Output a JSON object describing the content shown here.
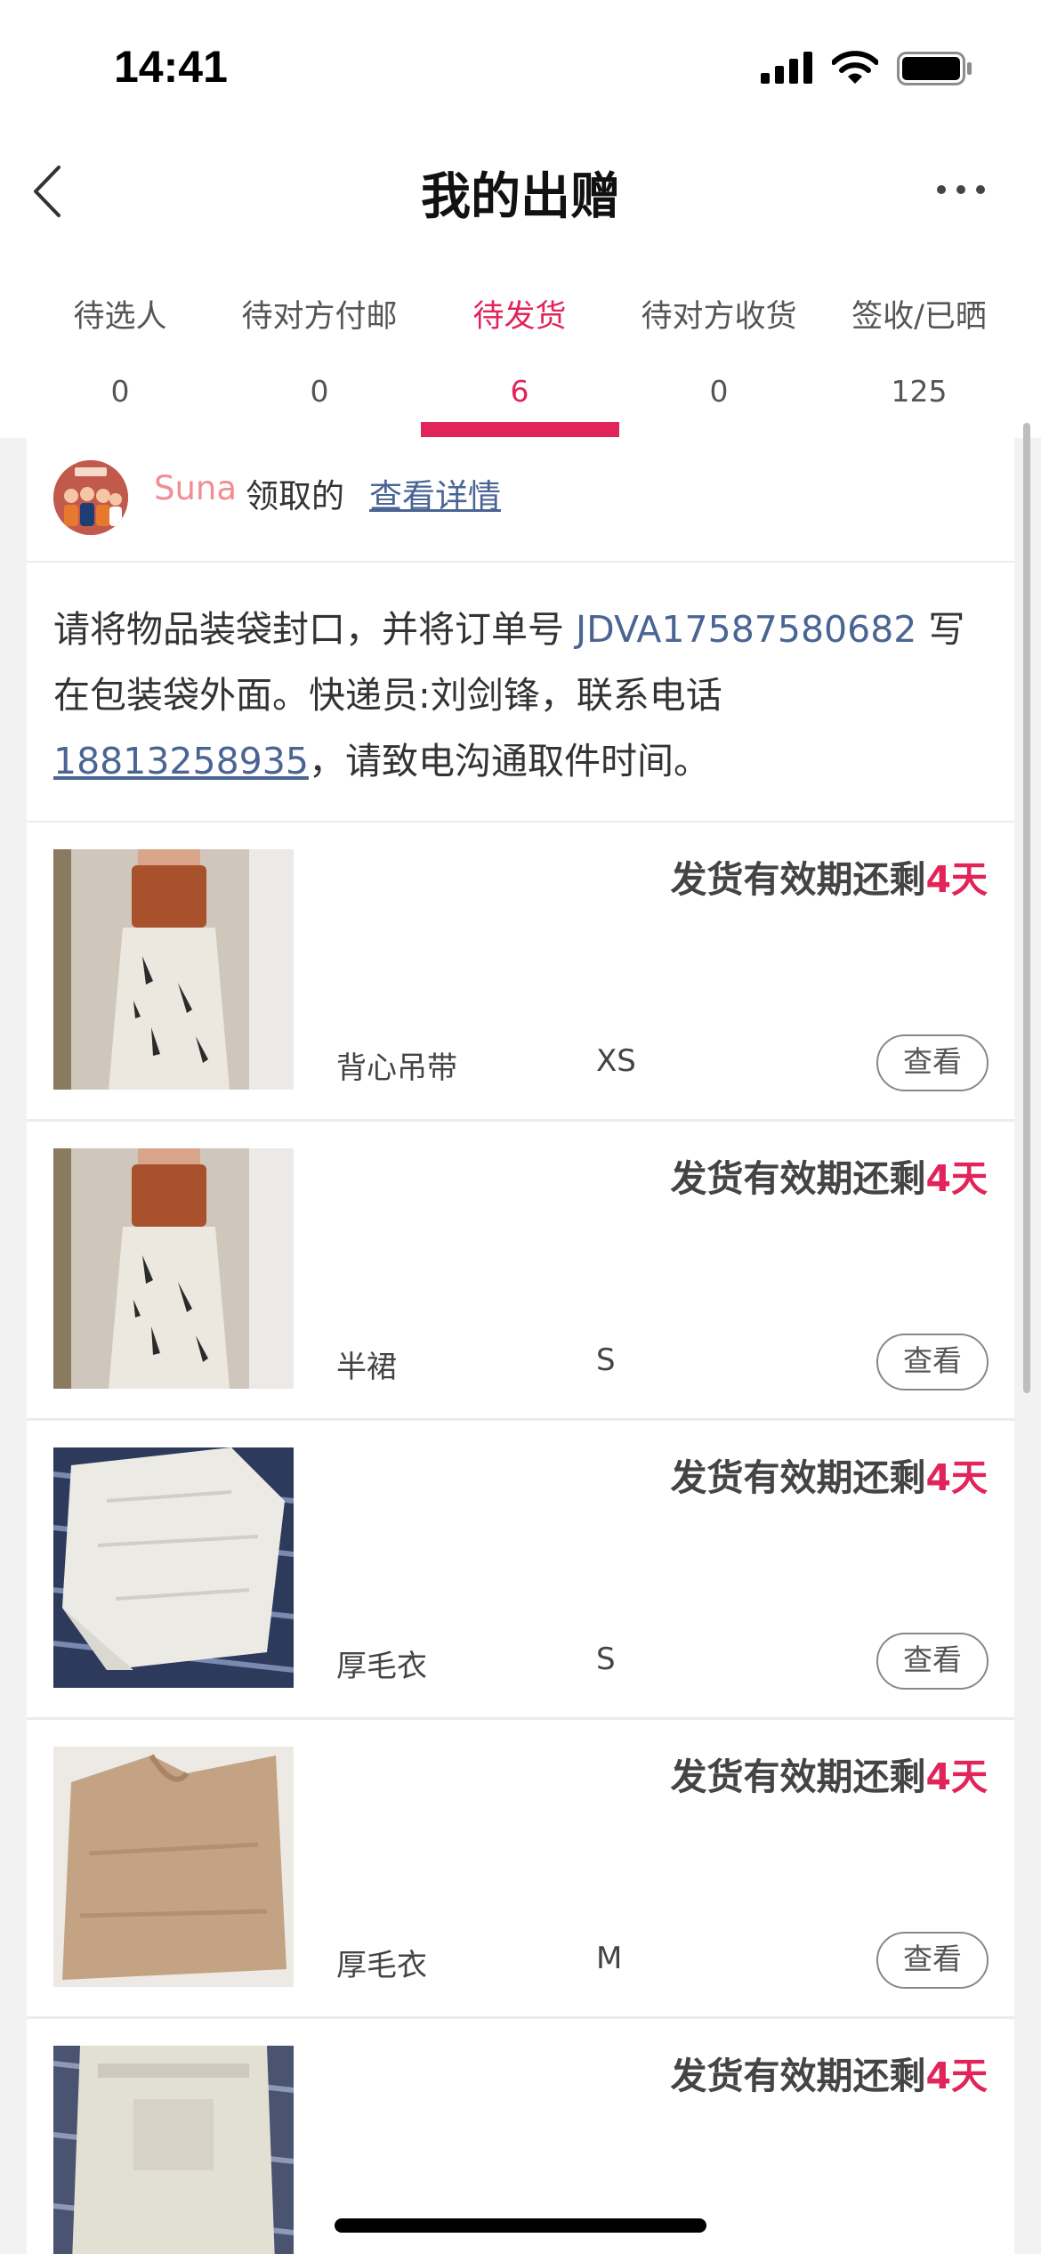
{
  "status_bar": {
    "time": "14:41"
  },
  "nav": {
    "title": "我的出赠"
  },
  "tabs": [
    {
      "label": "待选人",
      "count": "0"
    },
    {
      "label": "待对方付邮",
      "count": "0"
    },
    {
      "label": "待发货",
      "count": "6"
    },
    {
      "label": "待对方收货",
      "count": "0"
    },
    {
      "label": "签收/已晒",
      "count": "125"
    }
  ],
  "accent_color": "#e1245a",
  "claim": {
    "user_name": "Suna",
    "suffix": "领取的",
    "detail_link": "查看详情"
  },
  "instructions": {
    "part1": "请将物品装袋封口，并将订单号 ",
    "order_number": "JDVA17587580682",
    "part2": " 写在包装袋外面。快递员:刘剑锋，联系电话",
    "phone": "18813258935",
    "part3": "，请致电沟通取件时间。"
  },
  "items": [
    {
      "deadline_prefix": "发货有效期还剩",
      "days": "4天",
      "name": "背心吊带",
      "size": "XS",
      "view_label": "查看"
    },
    {
      "deadline_prefix": "发货有效期还剩",
      "days": "4天",
      "name": "半裙",
      "size": "S",
      "view_label": "查看"
    },
    {
      "deadline_prefix": "发货有效期还剩",
      "days": "4天",
      "name": "厚毛衣",
      "size": "S",
      "view_label": "查看"
    },
    {
      "deadline_prefix": "发货有效期还剩",
      "days": "4天",
      "name": "厚毛衣",
      "size": "M",
      "view_label": "查看"
    },
    {
      "deadline_prefix": "发货有效期还剩",
      "days": "4天",
      "name": "",
      "size": "",
      "view_label": ""
    }
  ]
}
